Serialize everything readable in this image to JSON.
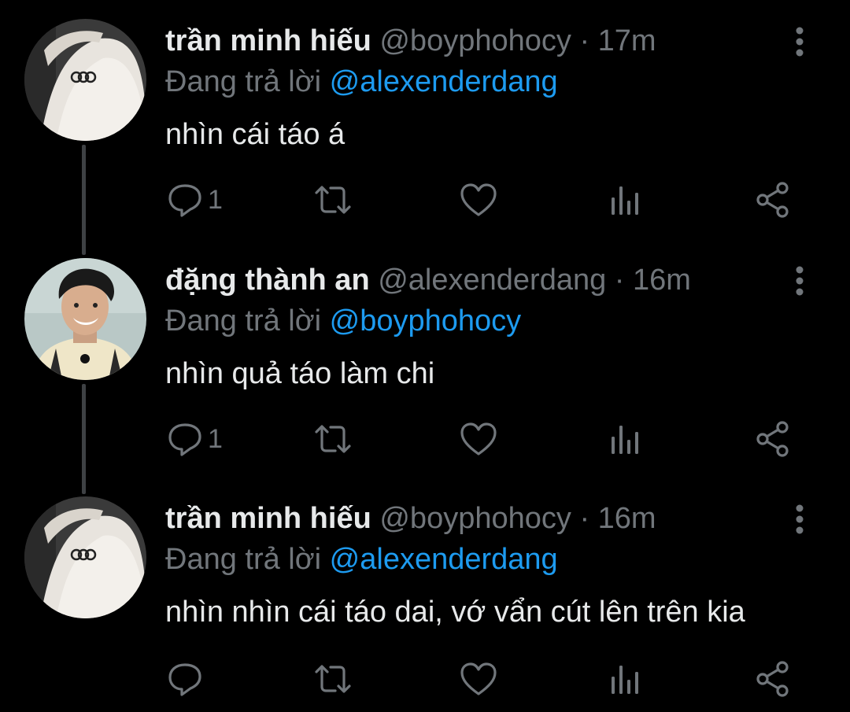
{
  "tweets": [
    {
      "name": "trần minh hiếu",
      "handle": "@boyphohocy",
      "separator": "·",
      "time": "17m",
      "reply_prefix": "Đang trả lời",
      "reply_to": "@alexenderdang",
      "text": "nhìn cái táo á",
      "reply_count": "1",
      "avatar": "tattoo-shoulder"
    },
    {
      "name": "đặng thành an",
      "handle": "@alexenderdang",
      "separator": "·",
      "time": "16m",
      "reply_prefix": "Đang trả lời",
      "reply_to": "@boyphohocy",
      "text": "nhìn quả táo làm chi",
      "reply_count": "1",
      "avatar": "smiling-man"
    },
    {
      "name": "trần minh hiếu",
      "handle": "@boyphohocy",
      "separator": "·",
      "time": "16m",
      "reply_prefix": "Đang trả lời",
      "reply_to": "@alexenderdang",
      "text": "nhìn nhìn cái táo dai, vớ vẩn cút lên trên kia",
      "reply_count": "",
      "avatar": "tattoo-shoulder"
    }
  ],
  "icons": [
    "reply-icon",
    "retweet-icon",
    "like-icon",
    "analytics-icon",
    "share-icon",
    "more-options-icon"
  ],
  "colors": {
    "background": "#000000",
    "text": "#e7e9ea",
    "secondary": "#71767b",
    "accent": "#1d9bf0",
    "thread_line": "#3e4144"
  }
}
